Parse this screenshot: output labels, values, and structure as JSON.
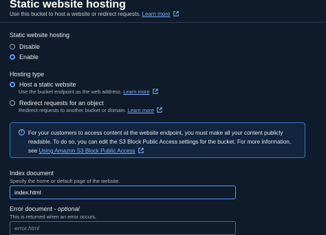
{
  "header": {
    "title": "Static website hosting",
    "description": "Use this bucket to host a website or redirect requests.",
    "learn_more": "Learn more"
  },
  "static_hosting": {
    "label": "Static website hosting",
    "options": [
      {
        "label": "Disable",
        "checked": false
      },
      {
        "label": "Enable",
        "checked": true
      }
    ]
  },
  "hosting_type": {
    "label": "Hosting type",
    "options": [
      {
        "label": "Host a static website",
        "description": "Use the bucket endpoint as the web address.",
        "link": "Learn more",
        "checked": true
      },
      {
        "label": "Redirect requests for an object",
        "description": "Redirect requests to another bucket or domain.",
        "link": "Learn more",
        "checked": false
      }
    ]
  },
  "info_box": {
    "text": "For your customers to access content at the website endpoint, you must make all your content publicly readable. To do so, you can edit the S3 Block Public Access settings for the bucket. For more information, see",
    "link": "Using Amazon S3 Block Public Access"
  },
  "index_document": {
    "label": "Index document",
    "description": "Specify the home or default page of the website.",
    "value": "index.html"
  },
  "error_document": {
    "label": "Error document",
    "optional": "optional",
    "separator": " - ",
    "description": "This is returned when an error occurs.",
    "placeholder": "error.html"
  },
  "colors": {
    "background": "#0f1b2a",
    "accent": "#5b9cff",
    "link": "#7fb0ff",
    "info_border": "#3f73c5"
  }
}
